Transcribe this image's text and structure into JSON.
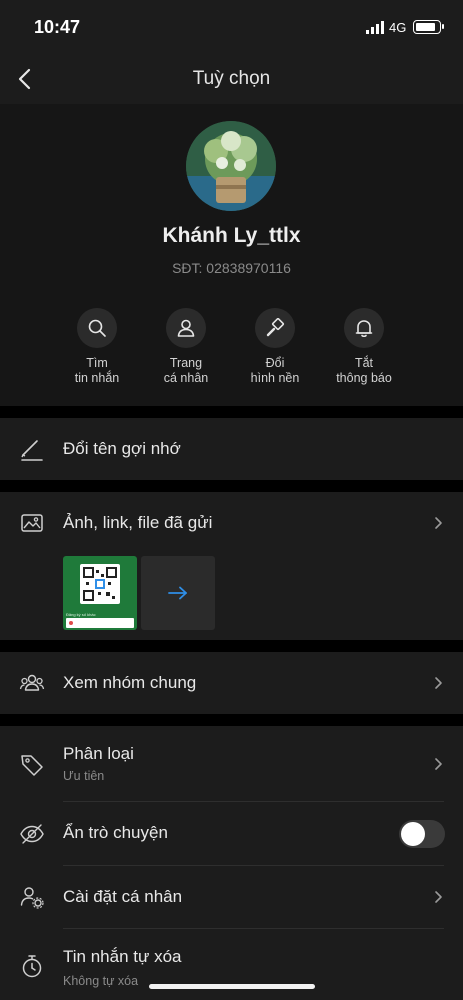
{
  "status": {
    "time": "10:47",
    "network": "4G"
  },
  "header": {
    "title": "Tuỳ chọn"
  },
  "profile": {
    "name": "Khánh Ly_ttlx",
    "phone": "SĐT: 02838970116",
    "actions": [
      {
        "line1": "Tìm",
        "line2": "tin nhắn",
        "icon": "search-icon"
      },
      {
        "line1": "Trang",
        "line2": "cá nhân",
        "icon": "person-icon"
      },
      {
        "line1": "Đổi",
        "line2": "hình nền",
        "icon": "paint-brush-icon"
      },
      {
        "line1": "Tắt",
        "line2": "thông báo",
        "icon": "bell-icon"
      }
    ]
  },
  "rename": {
    "label": "Đổi tên gợi nhớ",
    "icon": "pencil-icon"
  },
  "media": {
    "label": "Ảnh, link, file đã gửi",
    "icon": "photo-icon",
    "qr_caption": "Đăng ký số khác"
  },
  "groups": {
    "label": "Xem nhóm chung",
    "icon": "group-icon"
  },
  "classify": {
    "label": "Phân loại",
    "sub": "Ưu tiên",
    "icon": "tag-icon"
  },
  "hide_chat": {
    "label": "Ẩn trò chuyện",
    "icon": "eye-off-icon",
    "enabled": false
  },
  "personal_settings": {
    "label": "Cài đặt cá nhân",
    "icon": "user-gear-icon"
  },
  "auto_delete": {
    "label": "Tin nhắn tự xóa",
    "sub": "Không tự xóa",
    "icon": "stopwatch-icon"
  },
  "colors": {
    "background": "#1c1c1c",
    "accent_blue": "#2f8fe8",
    "text": "#e8e8e8",
    "muted": "#8a8a8a"
  }
}
